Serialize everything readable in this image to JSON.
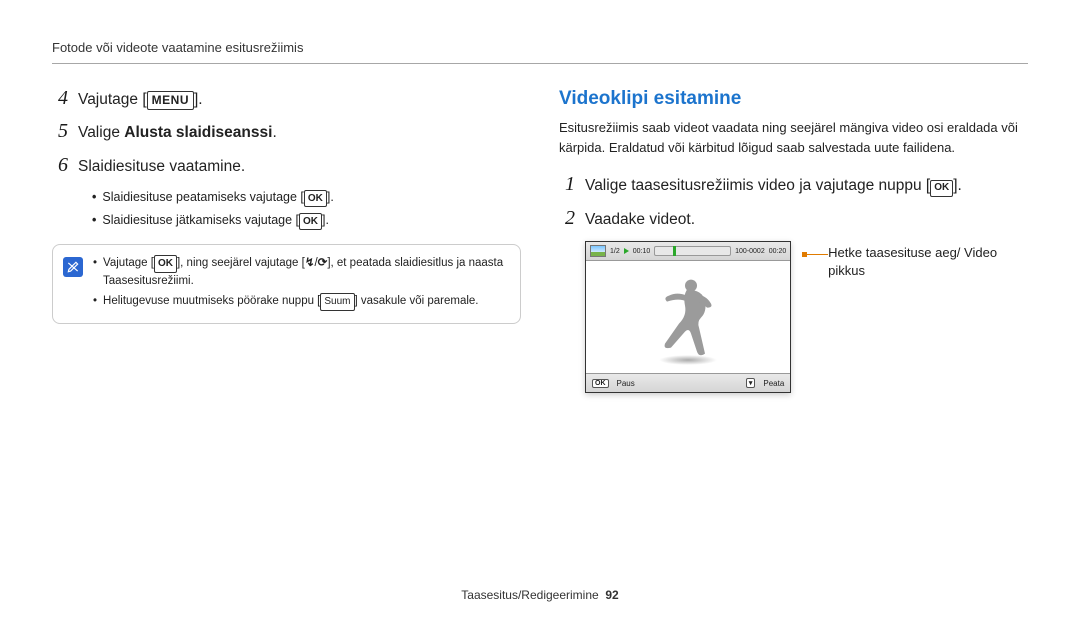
{
  "header": {
    "section_title": "Fotode või videote vaatamine esitusrežiimis"
  },
  "left": {
    "steps": [
      {
        "num": "4",
        "prefix": "Vajutage [",
        "pill": "MENU",
        "suffix": "]."
      },
      {
        "num": "5",
        "prefix": "Valige ",
        "bold": "Alusta slaidiseanssi",
        "suffix": "."
      },
      {
        "num": "6",
        "text": "Slaidiesituse vaatamine."
      }
    ],
    "bullets": [
      {
        "pre": "Slaidiesituse peatamiseks vajutage [",
        "pill": "OK",
        "post": "]."
      },
      {
        "pre": "Slaidiesituse jätkamiseks vajutage [",
        "pill": "OK",
        "post": "]."
      }
    ],
    "note": [
      {
        "pre": "Vajutage [",
        "pill": "OK",
        "mid": "], ning seejärel vajutage [",
        "glyph1": "↯",
        "sep": "/",
        "glyph2": "⟳",
        "post": "], et peatada slaidiesitlus ja naasta Taasesitusrežiimi."
      },
      {
        "pre": "Helitugevuse muutmiseks pöörake nuppu [",
        "suum": "Suum",
        "post": "] vasakule või paremale."
      }
    ]
  },
  "right": {
    "heading": "Videoklipi esitamine",
    "intro": "Esitusrežiimis saab videot vaadata ning seejärel mängiva video osi eraldada või kärpida. Eraldatud või kärbitud lõigud saab salvestada uute failidena.",
    "steps": [
      {
        "num": "1",
        "pre": "Valige taasesitusrežiimis video ja vajutage nuppu [",
        "pill": "OK",
        "post": "]."
      },
      {
        "num": "2",
        "text": "Vaadake videot."
      }
    ],
    "frame": {
      "counter": "1/2",
      "time_left": "00:10",
      "icons_note": "100-0002",
      "time_right": "00:20",
      "paus_label": "Paus",
      "peata_label": "Peata",
      "ok_pill": "OK"
    },
    "callout": "Hetke taasesituse aeg/ Video pikkus"
  },
  "footer": {
    "left": "Taasesitus/Redigeerimine",
    "page_no": "92"
  }
}
